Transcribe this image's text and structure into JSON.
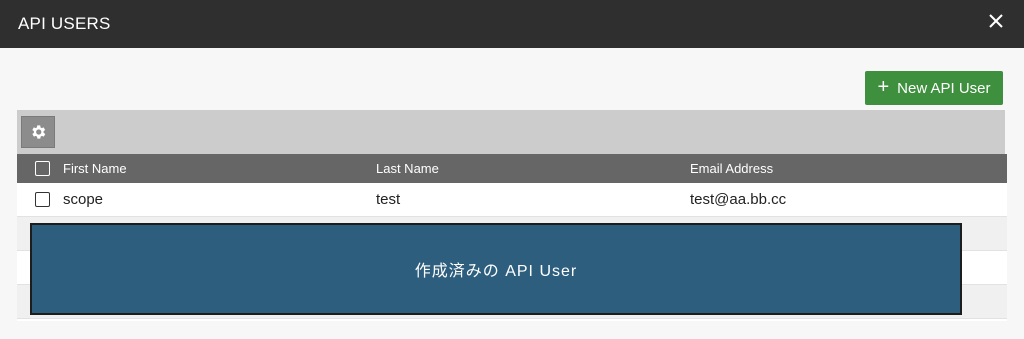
{
  "dialog": {
    "title": "API USERS",
    "close_label": "×"
  },
  "actions": {
    "new_button_label": "New API User",
    "new_button_icon": "plus-icon",
    "settings_icon": "gear-icon"
  },
  "table": {
    "columns": [
      "First Name",
      "Last Name",
      "Email Address"
    ],
    "rows": [
      {
        "first_name": "scope",
        "last_name": "test",
        "email": "test@aa.bb.cc"
      }
    ]
  },
  "overlay": {
    "caption": "作成済みの API User"
  },
  "colors": {
    "titlebar": "#2f2f2f",
    "primary_button": "#3e8f3e",
    "table_header": "#666666",
    "toolbar": "#cccccc",
    "overlay": "#2e5e7e"
  }
}
